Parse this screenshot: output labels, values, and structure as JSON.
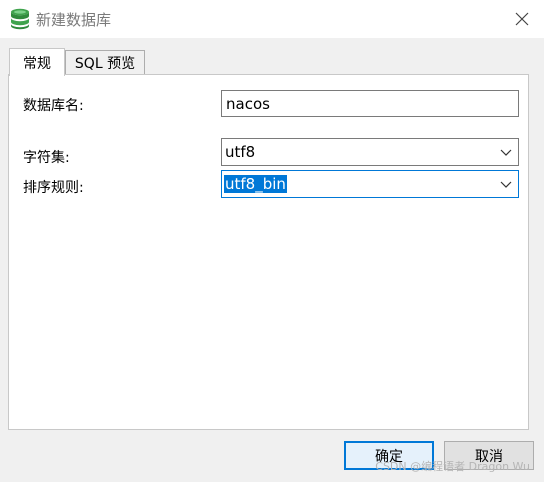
{
  "window": {
    "title": "新建数据库",
    "app_icon": "database-icon",
    "close_icon": "close-icon"
  },
  "tabs": [
    {
      "label": "常规",
      "active": true
    },
    {
      "label": "SQL 预览",
      "active": false
    }
  ],
  "form": {
    "name_label": "数据库名:",
    "name_value": "nacos",
    "charset_label": "字符集:",
    "charset_value": "utf8",
    "collation_label": "排序规则:",
    "collation_value": "utf8_bin"
  },
  "buttons": {
    "ok": "确定",
    "cancel": "取消"
  },
  "watermark": "CSDN @编程语者 Dragon Wu",
  "colors": {
    "accent": "#0078d7",
    "icon_green": "#3fa34d"
  }
}
